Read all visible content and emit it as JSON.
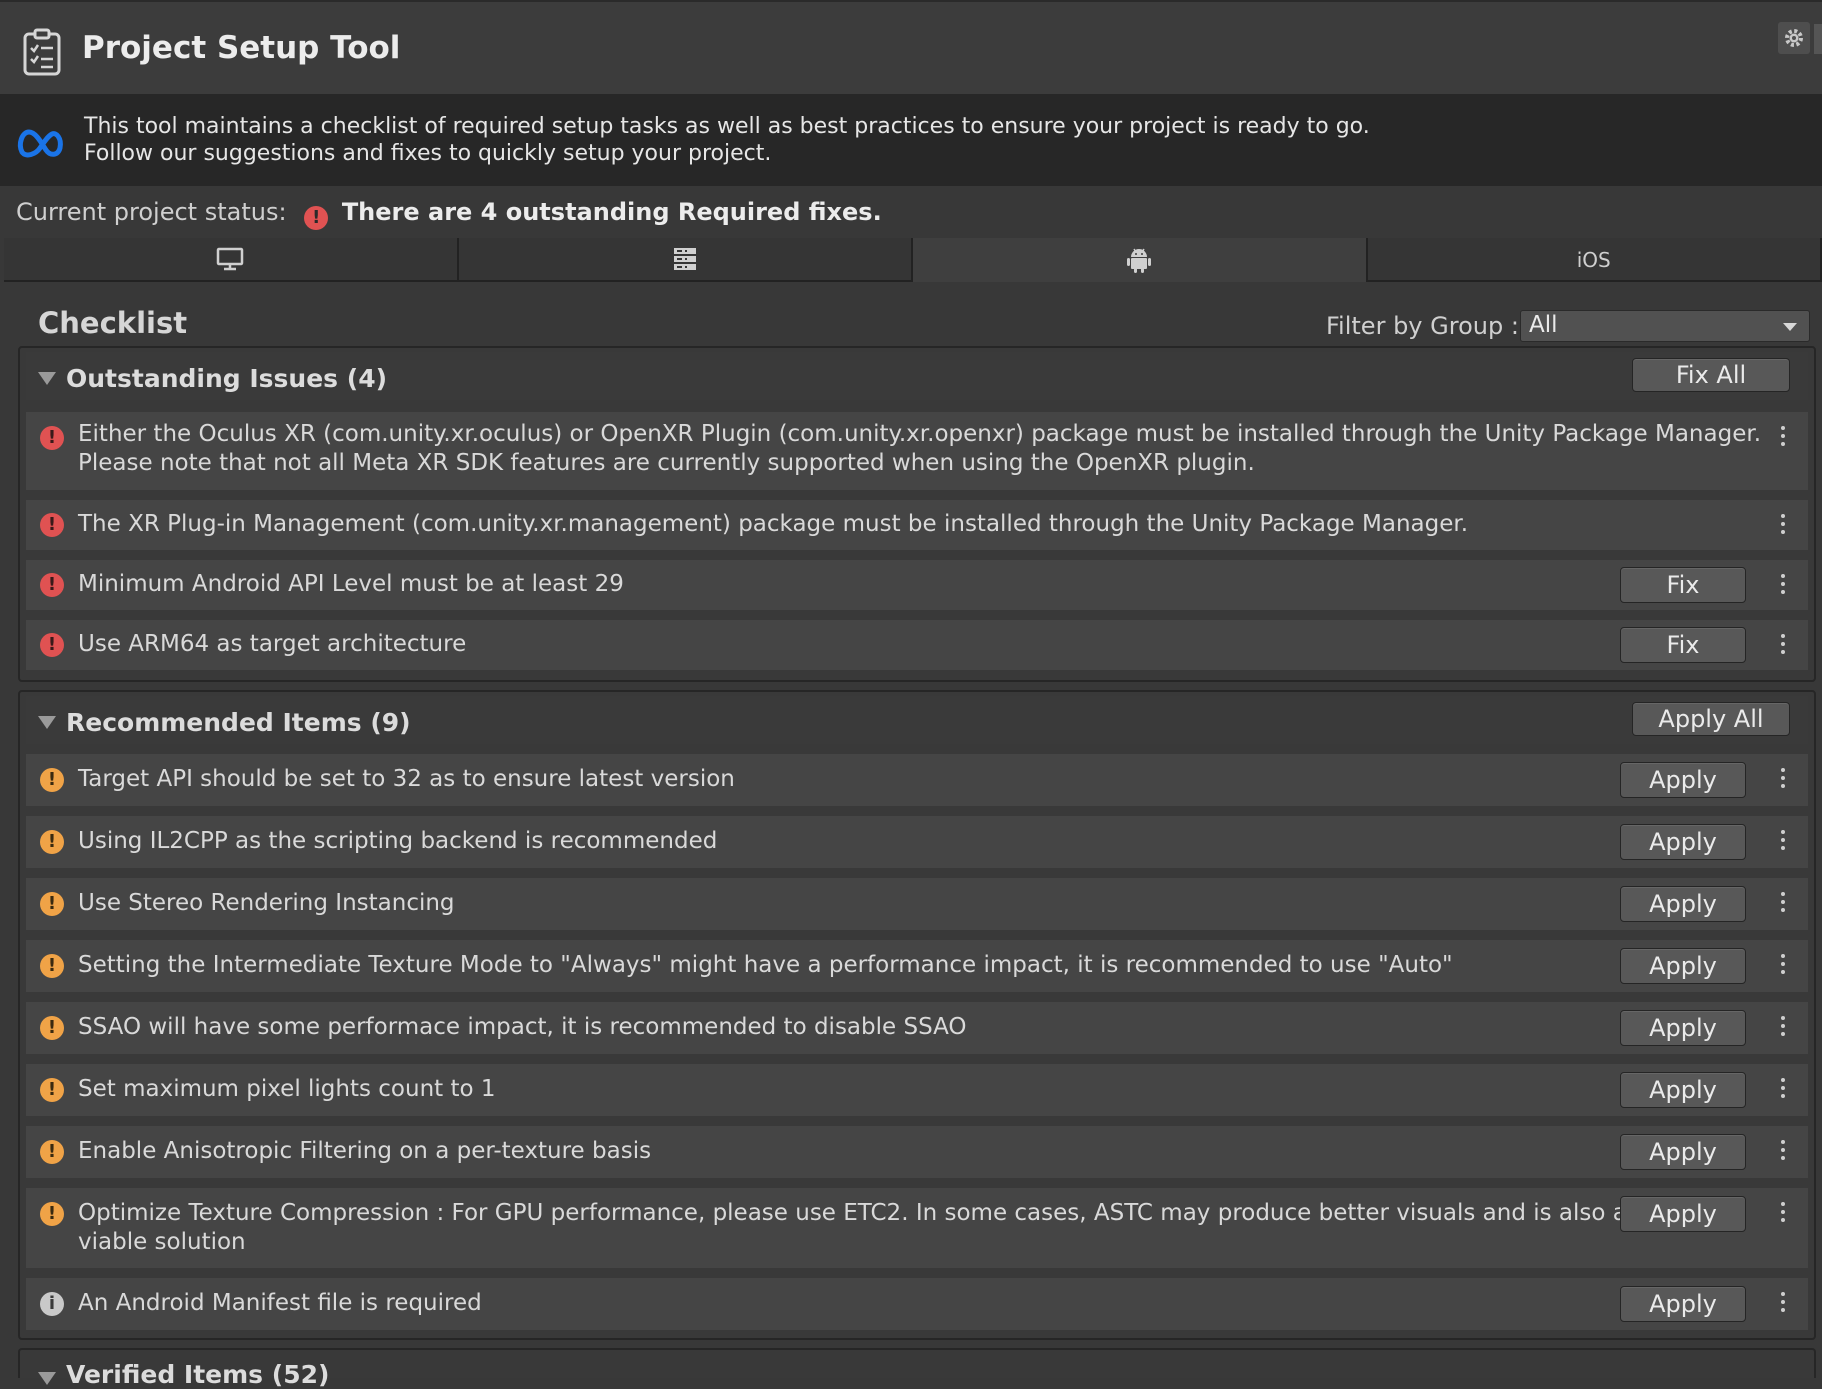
{
  "window": {
    "title": "Project Setup Tool",
    "icons": {
      "title": "clipboard-checklist-icon",
      "settings": "gear-icon"
    }
  },
  "info": {
    "line1": "This tool maintains a checklist of required setup tasks as well as best practices to ensure your project is ready to go.",
    "line2": "Follow our suggestions and fixes to quickly setup your project.",
    "logo": "meta-logo-icon"
  },
  "status": {
    "label": "Current project status:",
    "icon_glyph": "!",
    "text": "There are 4 outstanding Required fixes."
  },
  "tabs": [
    {
      "icon": "desktop-icon",
      "active": false
    },
    {
      "icon": "server-icon",
      "active": false
    },
    {
      "icon": "android-icon",
      "active": true
    },
    {
      "label": "iOS",
      "active": false
    }
  ],
  "checklist": {
    "title": "Checklist",
    "filter_label": "Filter by Group :",
    "filter_value": "All"
  },
  "outstanding": {
    "title": "Outstanding Issues (4)",
    "action": "Fix All",
    "items": [
      {
        "level": "error",
        "glyph": "!",
        "line1": "Either the Oculus XR (com.unity.xr.oculus) or OpenXR Plugin (com.unity.xr.openxr) package must be installed through the Unity Package Manager.",
        "line2": "Please note that not all Meta XR SDK features are currently supported when using the OpenXR plugin.",
        "button": ""
      },
      {
        "level": "error",
        "glyph": "!",
        "line1": "The XR Plug-in Management (com.unity.xr.management) package must be installed through the Unity Package Manager.",
        "line2": "",
        "button": ""
      },
      {
        "level": "error",
        "glyph": "!",
        "line1": "Minimum Android API Level must be at least 29",
        "line2": "",
        "button": "Fix"
      },
      {
        "level": "error",
        "glyph": "!",
        "line1": "Use ARM64 as target architecture",
        "line2": "",
        "button": "Fix"
      }
    ]
  },
  "recommended": {
    "title": "Recommended Items (9)",
    "action": "Apply All",
    "items": [
      {
        "level": "warning",
        "glyph": "!",
        "line1": "Target API should be set to 32 as to ensure latest version",
        "line2": "",
        "button": "Apply"
      },
      {
        "level": "warning",
        "glyph": "!",
        "line1": "Using IL2CPP as the scripting backend is recommended",
        "line2": "",
        "button": "Apply"
      },
      {
        "level": "warning",
        "glyph": "!",
        "line1": "Use Stereo Rendering Instancing",
        "line2": "",
        "button": "Apply"
      },
      {
        "level": "warning",
        "glyph": "!",
        "line1": "Setting the Intermediate Texture Mode to \"Always\" might have a performance impact, it is recommended to use \"Auto\"",
        "line2": "",
        "button": "Apply"
      },
      {
        "level": "warning",
        "glyph": "!",
        "line1": "SSAO will have some performace impact, it is recommended to disable SSAO",
        "line2": "",
        "button": "Apply"
      },
      {
        "level": "warning",
        "glyph": "!",
        "line1": "Set maximum pixel lights count to 1",
        "line2": "",
        "button": "Apply"
      },
      {
        "level": "warning",
        "glyph": "!",
        "line1": "Enable Anisotropic Filtering on a per-texture basis",
        "line2": "",
        "button": "Apply"
      },
      {
        "level": "warning",
        "glyph": "!",
        "line1": "Optimize Texture Compression : For GPU performance, please use ETC2. In some cases, ASTC may produce better visuals and is also a",
        "line2": "viable solution",
        "button": "Apply"
      },
      {
        "level": "info",
        "glyph": "i",
        "line1": "An Android Manifest file is required",
        "line2": "",
        "button": "Apply"
      }
    ]
  },
  "verified": {
    "title": "Verified Items (52)"
  },
  "colors": {
    "error": "#e05252",
    "warning": "#f0a347",
    "info": "#c9c9c9",
    "meta_blue": "#1a74e8"
  }
}
